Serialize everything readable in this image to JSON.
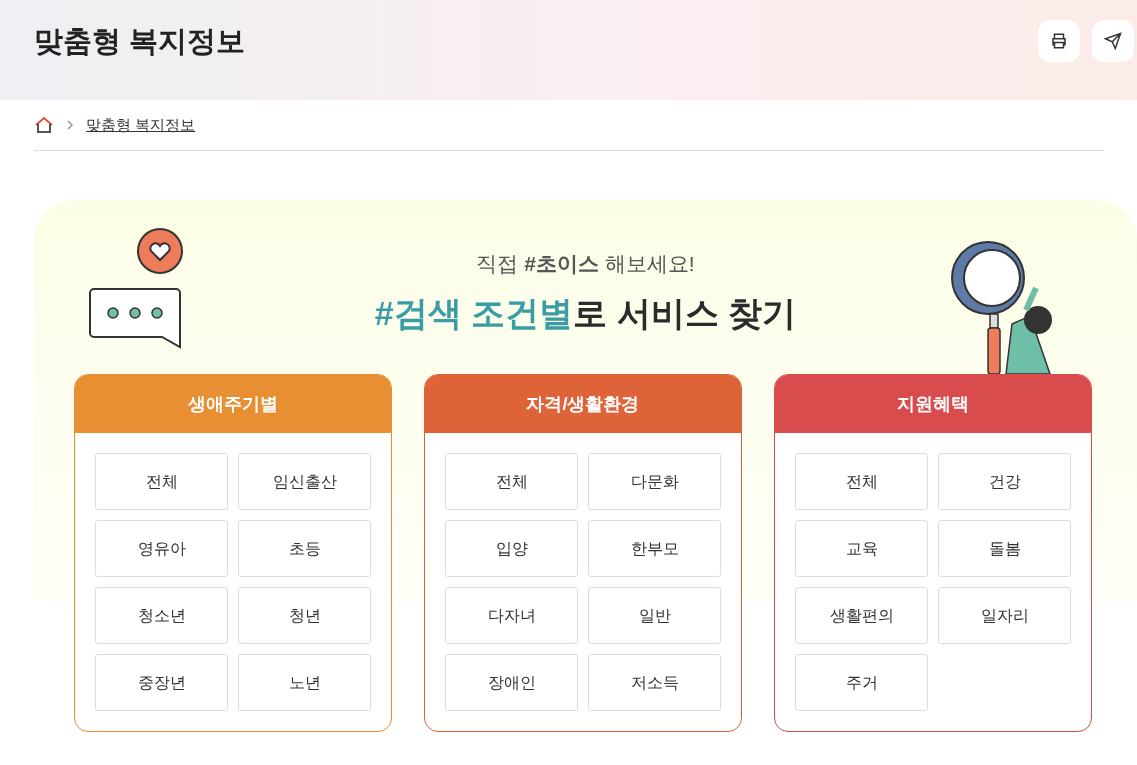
{
  "header": {
    "title": "맞춤형 복지정보"
  },
  "breadcrumb": [
    {
      "label": "맞춤형 복지정보"
    }
  ],
  "hero": {
    "subtitle": "직접 **#초이스** 해보세요!",
    "headline_highlight": "#검색 조건별",
    "headline_rest": "로 서비스 찾기"
  },
  "categories": [
    {
      "title": "생애주기별",
      "color": "#e98f33",
      "options": [
        "전체",
        "임신출산",
        "영유아",
        "초등",
        "청소년",
        "청년",
        "중장년",
        "노년"
      ]
    },
    {
      "title": "자격/생활환경",
      "color": "#de6339",
      "options": [
        "전체",
        "다문화",
        "입양",
        "한부모",
        "다자녀",
        "일반",
        "장애인",
        "저소득"
      ]
    },
    {
      "title": "지원혜택",
      "color": "#d84c4d",
      "options": [
        "전체",
        "건강",
        "교육",
        "돌봄",
        "생활편의",
        "일자리",
        "주거"
      ]
    }
  ]
}
